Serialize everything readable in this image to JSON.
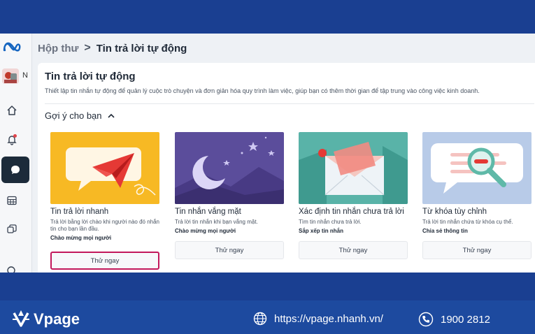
{
  "breadcrumb": {
    "parent": "Hộp thư",
    "separator": ">",
    "current": "Tin trả lời tự động"
  },
  "rail": {
    "avatar_letter": "N"
  },
  "panel": {
    "title": "Tin trả lời tự động",
    "description": "Thiết lập tin nhắn tự động để quản lý cuộc trò chuyện và đơn giản hóa quy trình làm việc, giúp bạn có thêm thời gian để tập trung vào công việc kinh doanh.",
    "section_title": "Gợi ý cho bạn"
  },
  "cards": [
    {
      "title": "Tin trả lời nhanh",
      "subtitle": "Trả lời bằng lời chào khi người nào đó nhắn tin cho bạn lần đầu.",
      "tag": "Chào mừng mọi người",
      "button": "Thử ngay"
    },
    {
      "title": "Tin nhắn vắng mặt",
      "subtitle": "Trả lời tin nhắn khi bạn vắng mặt.",
      "tag": "Chào mừng mọi người",
      "button": "Thử ngay"
    },
    {
      "title": "Xác định tin nhắn chưa trả lời",
      "subtitle": "Tìm tin nhắn chưa trả lời.",
      "tag": "Sắp xếp tin nhắn",
      "button": "Thử ngay"
    },
    {
      "title": "Từ khóa tùy chỉnh",
      "subtitle": "Trả lời tin nhắn chứa từ khóa cụ thể.",
      "tag": "Chia sẻ thông tin",
      "button": "Thử ngay"
    }
  ],
  "footer": {
    "brand": "Vpage",
    "website": "https://vpage.nhanh.vn/",
    "phone": "1900 2812"
  },
  "colors": {
    "brand_blue": "#1a3f91",
    "highlight": "#c2185b",
    "active_rail": "#1c2b3a"
  }
}
